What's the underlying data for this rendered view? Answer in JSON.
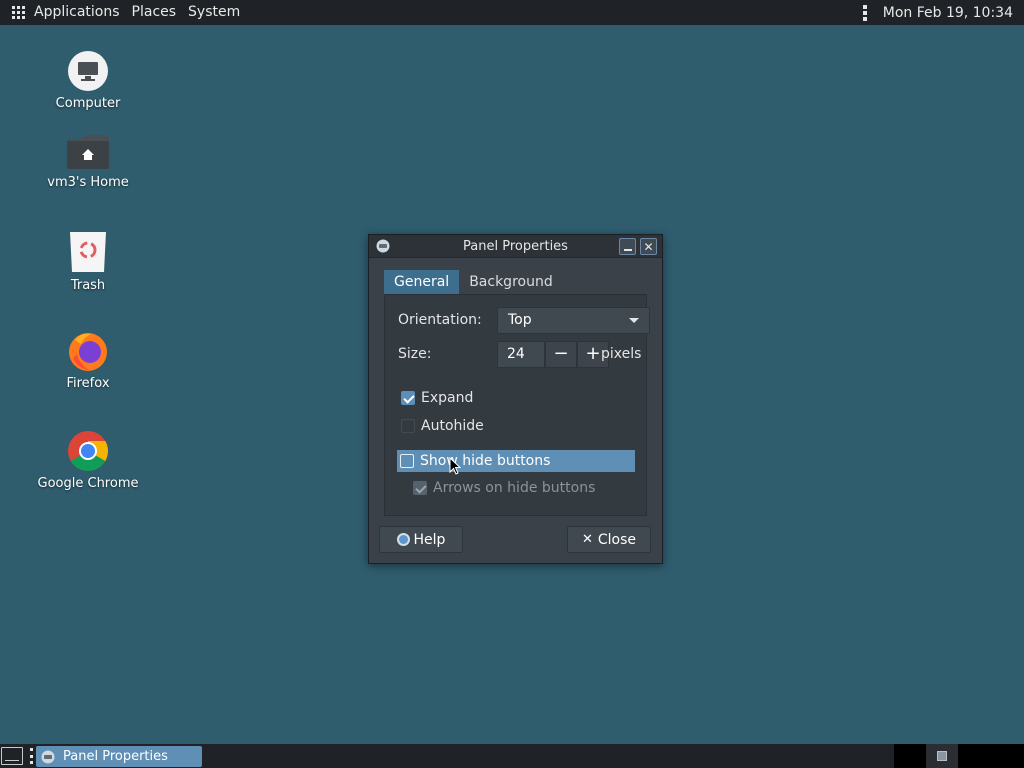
{
  "topbar": {
    "menus": [
      "Applications",
      "Places",
      "System"
    ],
    "clock": "Mon Feb 19, 10:34",
    "apps_icon": "grid-icon",
    "overflow_icon": "kebab-icon"
  },
  "desktop": {
    "icons": [
      {
        "label": "Computer",
        "icon": "computer-icon"
      },
      {
        "label": "vm3's Home",
        "icon": "home-folder-icon"
      },
      {
        "label": "Trash",
        "icon": "trash-icon"
      },
      {
        "label": "Firefox",
        "icon": "firefox-icon"
      },
      {
        "label": "Google Chrome",
        "icon": "chrome-icon"
      }
    ]
  },
  "dialog": {
    "title": "Panel Properties",
    "tabs": [
      {
        "label": "General",
        "active": true
      },
      {
        "label": "Background",
        "active": false
      }
    ],
    "orientation": {
      "label": "Orientation:",
      "value": "Top"
    },
    "size": {
      "label": "Size:",
      "value": "24",
      "minus": "−",
      "plus": "+",
      "unit": "pixels"
    },
    "checks": {
      "expand": {
        "label": "Expand",
        "checked": true
      },
      "autohide": {
        "label": "Autohide",
        "checked": false
      },
      "show_hide": {
        "label": "Show hide buttons",
        "checked": false
      },
      "arrows": {
        "label": "Arrows on hide buttons",
        "checked": true,
        "disabled": true
      }
    },
    "buttons": {
      "help": "Help",
      "close": "Close"
    }
  },
  "taskbar": {
    "window_button": "Panel Properties"
  },
  "colors": {
    "desktop_bg": "#2f5d6e",
    "panel_bg": "#1f2226",
    "accent": "#5f8fb4"
  }
}
